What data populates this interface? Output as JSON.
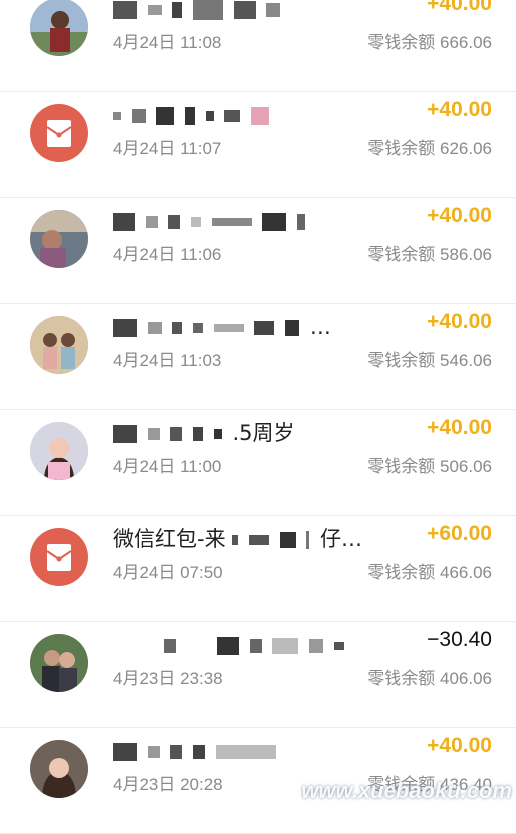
{
  "colors": {
    "income": "#f0b01c",
    "expense": "#111111",
    "redpacket": "#e0614f",
    "meta": "#8a8a8a"
  },
  "transactions": [
    {
      "avatar": "user-photo-avatar",
      "title_visible": "",
      "time": "4月24日 11:08",
      "amount": "+40.00",
      "type": "income",
      "balance": "零钱余额 666.06"
    },
    {
      "avatar": "red-packet-icon",
      "title_visible": "",
      "time": "4月24日 11:07",
      "amount": "+40.00",
      "type": "income",
      "balance": "零钱余额 626.06"
    },
    {
      "avatar": "user-photo-avatar",
      "title_visible": "",
      "time": "4月24日 11:06",
      "amount": "+40.00",
      "type": "income",
      "balance": "零钱余额 586.06"
    },
    {
      "avatar": "user-photo-avatar",
      "title_visible": "…",
      "time": "4月24日 11:03",
      "amount": "+40.00",
      "type": "income",
      "balance": "零钱余额 546.06"
    },
    {
      "avatar": "user-photo-avatar",
      "title_visible": ".5周岁",
      "time": "4月24日 11:00",
      "amount": "+40.00",
      "type": "income",
      "balance": "零钱余额 506.06"
    },
    {
      "avatar": "red-packet-icon",
      "title_prefix": "微信红包-来",
      "title_visible": "仔…",
      "time": "4月24日 07:50",
      "amount": "+60.00",
      "type": "income",
      "balance": "零钱余额 466.06"
    },
    {
      "avatar": "user-photo-avatar",
      "title_visible": "",
      "time": "4月23日 23:38",
      "amount": "−30.40",
      "type": "expense",
      "balance": "零钱余额 406.06"
    },
    {
      "avatar": "user-photo-avatar",
      "title_visible": "",
      "time": "4月23日 20:28",
      "amount": "+40.00",
      "type": "income",
      "balance": "零钱余额 436.40"
    }
  ],
  "watermark": "www.xuebaoku.com"
}
